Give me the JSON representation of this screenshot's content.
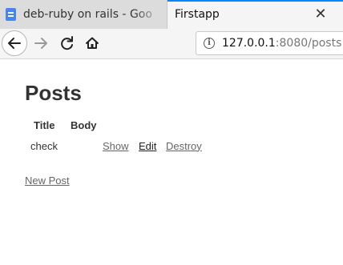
{
  "tabs": [
    {
      "title": "deb-ruby on rails - Goo",
      "favicon": "document-icon",
      "active": false
    },
    {
      "title": "Firstapp",
      "active": true,
      "close_glyph": "✕"
    }
  ],
  "nav": {
    "url_host": "127.0.0.1",
    "url_rest": ":8080/posts",
    "back": "back-arrow-icon",
    "forward": "forward-arrow-icon",
    "reload": "reload-icon",
    "home": "home-icon",
    "site_info": "i"
  },
  "page": {
    "heading": "Posts",
    "columns": [
      "Title",
      "Body"
    ],
    "rows": [
      {
        "title": "check",
        "body": "",
        "actions": [
          "Show",
          "Edit",
          "Destroy"
        ]
      }
    ],
    "new_link": "New Post"
  },
  "colors": {
    "active_tab_accent": "#0a84ff",
    "link": "#666666",
    "link_focused": "#222222"
  }
}
